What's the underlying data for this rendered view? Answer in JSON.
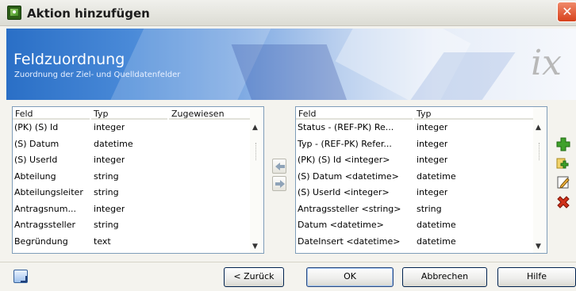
{
  "window": {
    "title": "Aktion hinzufügen"
  },
  "banner": {
    "title": "Feldzuordnung",
    "subtitle": "Zuordnung der Ziel- und Quelldatenfelder",
    "logo": "ix"
  },
  "left_list": {
    "columns": [
      "Feld",
      "Typ",
      "Zugewiesen"
    ],
    "rows": [
      [
        "(PK) (S) Id",
        "integer",
        ""
      ],
      [
        "(S) Datum",
        "datetime",
        ""
      ],
      [
        "(S) UserId",
        "integer",
        ""
      ],
      [
        "Abteilung",
        "string",
        ""
      ],
      [
        "Abteilungsleiter",
        "string",
        ""
      ],
      [
        "Antragsnum...",
        "integer",
        ""
      ],
      [
        "Antragssteller",
        "string",
        ""
      ],
      [
        "Begründung",
        "text",
        ""
      ]
    ]
  },
  "right_list": {
    "columns": [
      "Feld",
      "Typ"
    ],
    "rows": [
      [
        "Status - (REF-PK) Re...",
        "integer"
      ],
      [
        "Typ - (REF-PK) Refer...",
        "integer"
      ],
      [
        "(PK) (S) Id <integer>",
        "integer"
      ],
      [
        "(S) Datum <datetime>",
        "datetime"
      ],
      [
        "(S) UserId <integer>",
        "integer"
      ],
      [
        "Antragssteller <string>",
        "string"
      ],
      [
        "Datum <datetime>",
        "datetime"
      ],
      [
        "DateInsert <datetime>",
        "datetime"
      ]
    ]
  },
  "buttons": {
    "back": "< Zurück",
    "ok": "OK",
    "cancel": "Abbrechen",
    "help": "Hilfe"
  },
  "icons": {
    "app": "app-icon",
    "close": "close-icon",
    "move_left": "arrow-left-icon",
    "move_right": "arrow-right-icon",
    "add": "add-icon",
    "add_multiple": "add-fields-icon",
    "edit": "edit-icon",
    "delete": "delete-icon",
    "footer": "window-icon"
  },
  "colors": {
    "accent": "#2a6fc6",
    "add": "#3fa12b",
    "delete": "#d0311a"
  }
}
